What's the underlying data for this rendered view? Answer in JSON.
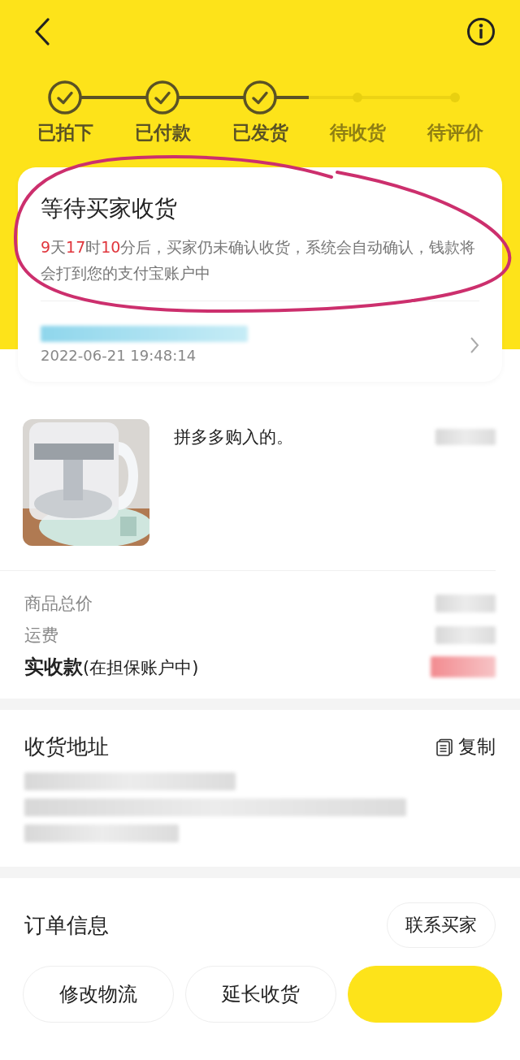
{
  "steps": [
    {
      "label": "已拍下",
      "done": true
    },
    {
      "label": "已付款",
      "done": true
    },
    {
      "label": "已发货",
      "done": true
    },
    {
      "label": "待收货",
      "done": false
    },
    {
      "label": "待评价",
      "done": false
    }
  ],
  "status_card": {
    "title": "等待买家收货",
    "message": [
      {
        "text": "9",
        "highlight": true
      },
      {
        "text": "天",
        "highlight": false
      },
      {
        "text": "17",
        "highlight": true
      },
      {
        "text": "时",
        "highlight": false
      },
      {
        "text": "10",
        "highlight": true
      },
      {
        "text": "分后，买家仍未确认收货，系统会自动确认，钱款将会打到您的支付宝账户中",
        "highlight": false
      }
    ],
    "time": "2022-06-21 19:48:14"
  },
  "product": {
    "title": "拼多多购入的。"
  },
  "price_rows": [
    {
      "label": "商品总价",
      "kind": "normal"
    },
    {
      "label": "运费",
      "kind": "normal"
    },
    {
      "label": "实收款",
      "note": "(在担保账户中)",
      "kind": "total"
    }
  ],
  "address": {
    "title": "收货地址",
    "copy_label": "复制"
  },
  "order_info": {
    "title": "订单信息",
    "contact_button": "联系买家"
  },
  "actions": [
    {
      "label": "修改物流",
      "kind": "outline"
    },
    {
      "label": "延长收货",
      "kind": "outline"
    },
    {
      "kind": "primary"
    }
  ]
}
